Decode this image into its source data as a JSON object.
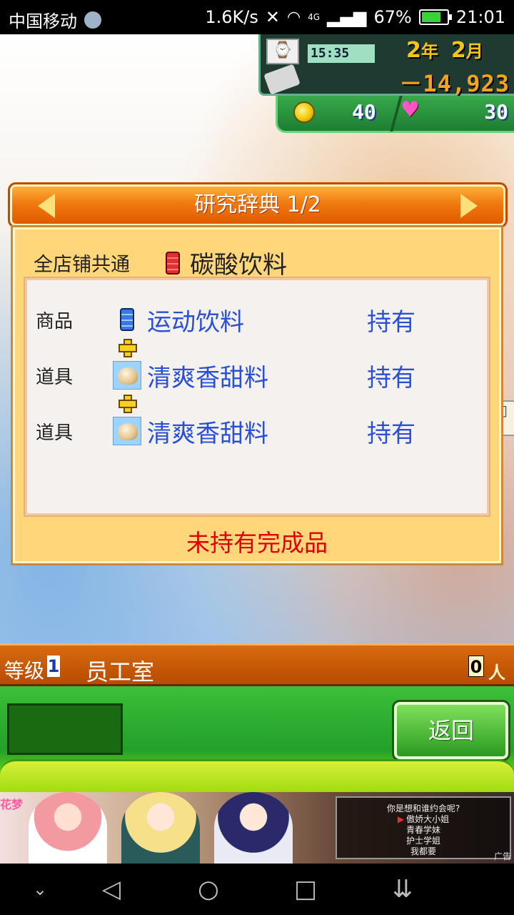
{
  "status_bar": {
    "carrier": "中国移动",
    "speed": "1.6K/s",
    "network": "4G",
    "battery": "67%",
    "time": "21:01"
  },
  "hud": {
    "clock_time": "15:35",
    "year_num": "2",
    "year_unit": "年",
    "month_num": "2",
    "month_unit": "月",
    "money": "－14,923",
    "coins": "40",
    "hearts": "30"
  },
  "dictionary": {
    "title": "研究辞典 1/2",
    "scope": "全店铺共通",
    "target_item": "碳酸饮料",
    "ingredients": [
      {
        "kind": "商品",
        "name": "运动饮料",
        "status": "持有",
        "icon": "blue-can-icon"
      },
      {
        "kind": "道具",
        "name": "清爽香甜料",
        "status": "持有",
        "icon": "sweetener-icon"
      },
      {
        "kind": "道具",
        "name": "清爽香甜料",
        "status": "持有",
        "icon": "sweetener-icon"
      }
    ],
    "footer": "未持有完成品"
  },
  "bottom_bar": {
    "level_label": "等级",
    "level_value": "1",
    "room_name": "员工室",
    "staff_count": "0",
    "back_button": "返回"
  },
  "ad": {
    "logo": "花梦",
    "question": "你是想和谁约会呢?",
    "options": [
      "傲娇大小姐",
      "青春学妹",
      "护士学姐",
      "我都要"
    ],
    "tag": "广告"
  },
  "colors": {
    "dialog_orange": "#f07a10",
    "ingredient_blue": "#2a4fd8",
    "warning_red": "#e00000",
    "button_green": "#2a9a22"
  }
}
